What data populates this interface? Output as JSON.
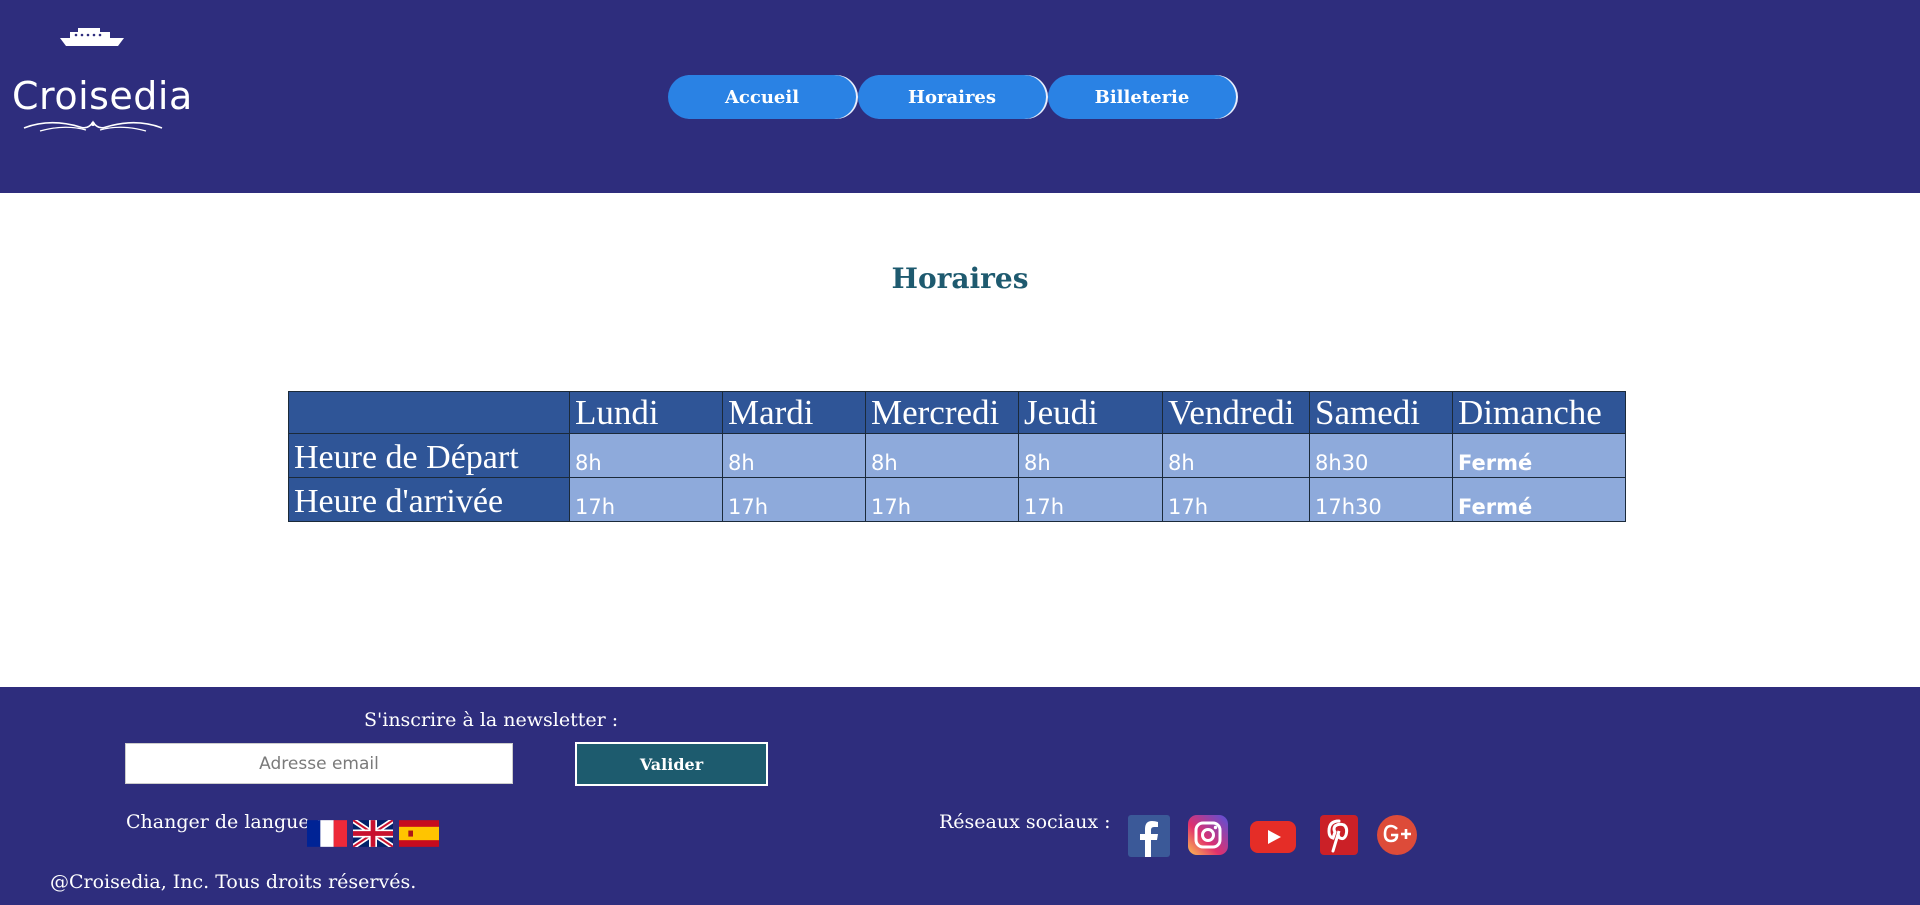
{
  "brand": {
    "name": "Croisedia"
  },
  "nav": {
    "items": [
      {
        "label": "Accueil"
      },
      {
        "label": "Horaires"
      },
      {
        "label": "Billeterie"
      }
    ]
  },
  "main": {
    "title": "Horaires",
    "table": {
      "headers": [
        "",
        "Lundi",
        "Mardi",
        "Mercredi",
        "Jeudi",
        "Vendredi",
        "Samedi",
        "Dimanche"
      ],
      "rows": [
        {
          "label": "Heure de Départ",
          "values": [
            "8h",
            "8h",
            "8h",
            "8h",
            "8h",
            "8h30",
            "Fermé"
          ]
        },
        {
          "label": "Heure d'arrivée",
          "values": [
            "17h",
            "17h",
            "17h",
            "17h",
            "17h",
            "17h30",
            "Fermé"
          ]
        }
      ]
    }
  },
  "footer": {
    "newsletter_label": "S'inscrire à la newsletter :",
    "email_placeholder": "Adresse email",
    "submit_label": "Valider",
    "language_label": "Changer de langue :",
    "languages": [
      {
        "icon": "france-flag-icon"
      },
      {
        "icon": "uk-flag-icon"
      },
      {
        "icon": "spain-flag-icon"
      }
    ],
    "social_label": "Réseaux sociaux :",
    "socials": [
      {
        "icon": "facebook-icon",
        "color": "#3b5998"
      },
      {
        "icon": "instagram-icon",
        "color": "#c13584"
      },
      {
        "icon": "youtube-icon",
        "color": "#e52d27"
      },
      {
        "icon": "pinterest-icon",
        "color": "#cb2027"
      },
      {
        "icon": "google-plus-icon",
        "color": "#dd4b39"
      }
    ],
    "copyright": "@Croisedia, Inc. Tous droits réservés."
  },
  "colors": {
    "header_bg": "#2e2d7d",
    "nav_button": "#2a82e4",
    "title_color": "#1e5a6f",
    "table_header": "#2f5597",
    "table_cell": "#8eaadb",
    "submit_button": "#1d5b6e"
  }
}
